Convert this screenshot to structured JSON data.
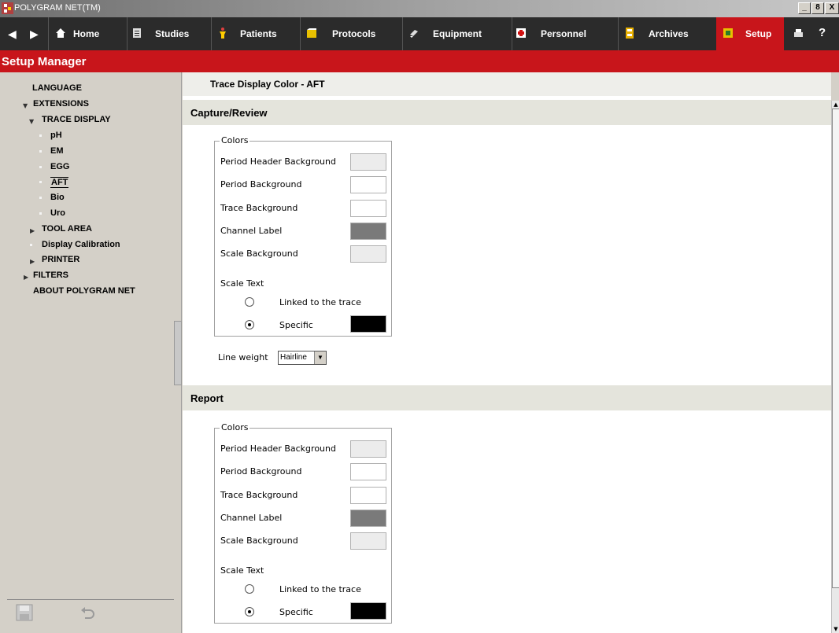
{
  "window": {
    "title": "POLYGRAM NET(TM)",
    "controls": [
      "_",
      "8",
      "X"
    ]
  },
  "nav": {
    "items": [
      {
        "label": "Home",
        "icon": "home-icon"
      },
      {
        "label": "Studies",
        "icon": "studies-icon"
      },
      {
        "label": "Patients",
        "icon": "patients-icon"
      },
      {
        "label": "Protocols",
        "icon": "protocols-icon"
      },
      {
        "label": "Equipment",
        "icon": "equipment-icon"
      },
      {
        "label": "Personnel",
        "icon": "personnel-icon"
      },
      {
        "label": "Archives",
        "icon": "archives-icon"
      },
      {
        "label": "Setup",
        "icon": "setup-icon"
      }
    ],
    "active": "Setup",
    "help": "?"
  },
  "header": {
    "title": "Setup Manager"
  },
  "sidebar": {
    "items": [
      {
        "label": "LANGUAGE"
      },
      {
        "label": "EXTENSIONS"
      },
      {
        "label": "TRACE DISPLAY"
      },
      {
        "label": "pH"
      },
      {
        "label": "EM"
      },
      {
        "label": "EGG"
      },
      {
        "label": "AFT"
      },
      {
        "label": "Bio"
      },
      {
        "label": "Uro"
      },
      {
        "label": "TOOL AREA"
      },
      {
        "label": "Display Calibration"
      },
      {
        "label": "PRINTER"
      },
      {
        "label": "FILTERS"
      },
      {
        "label": "ABOUT POLYGRAM NET"
      }
    ],
    "selected": "AFT"
  },
  "main": {
    "title": "Trace Display Color - AFT",
    "sections": [
      {
        "title": "Capture/Review",
        "group_label": "Colors",
        "rows": [
          {
            "label": "Period Header Background",
            "color": "#ececec"
          },
          {
            "label": "Period Background",
            "color": "#ffffff"
          },
          {
            "label": "Trace Background",
            "color": "#ffffff"
          },
          {
            "label": "Channel Label",
            "color": "#7a7a7a"
          },
          {
            "label": "Scale Background",
            "color": "#ececec"
          }
        ],
        "scale_text": {
          "label": "Scale Text",
          "options": [
            {
              "label": "Linked to the trace",
              "selected": false
            },
            {
              "label": "Specific",
              "selected": true,
              "color": "#000000"
            }
          ]
        },
        "line_weight": {
          "label": "Line weight",
          "value": "Hairline"
        }
      },
      {
        "title": "Report",
        "group_label": "Colors",
        "rows": [
          {
            "label": "Period Header Background",
            "color": "#ececec"
          },
          {
            "label": "Period Background",
            "color": "#ffffff"
          },
          {
            "label": "Trace Background",
            "color": "#ffffff"
          },
          {
            "label": "Channel Label",
            "color": "#7a7a7a"
          },
          {
            "label": "Scale Background",
            "color": "#ececec"
          }
        ],
        "scale_text": {
          "label": "Scale Text",
          "options": [
            {
              "label": "Linked to the trace",
              "selected": false
            },
            {
              "label": "Specific",
              "selected": true,
              "color": "#000000"
            }
          ]
        }
      }
    ]
  },
  "colors": {
    "accent": "#c8151b",
    "navbar": "#2b2b2b"
  }
}
